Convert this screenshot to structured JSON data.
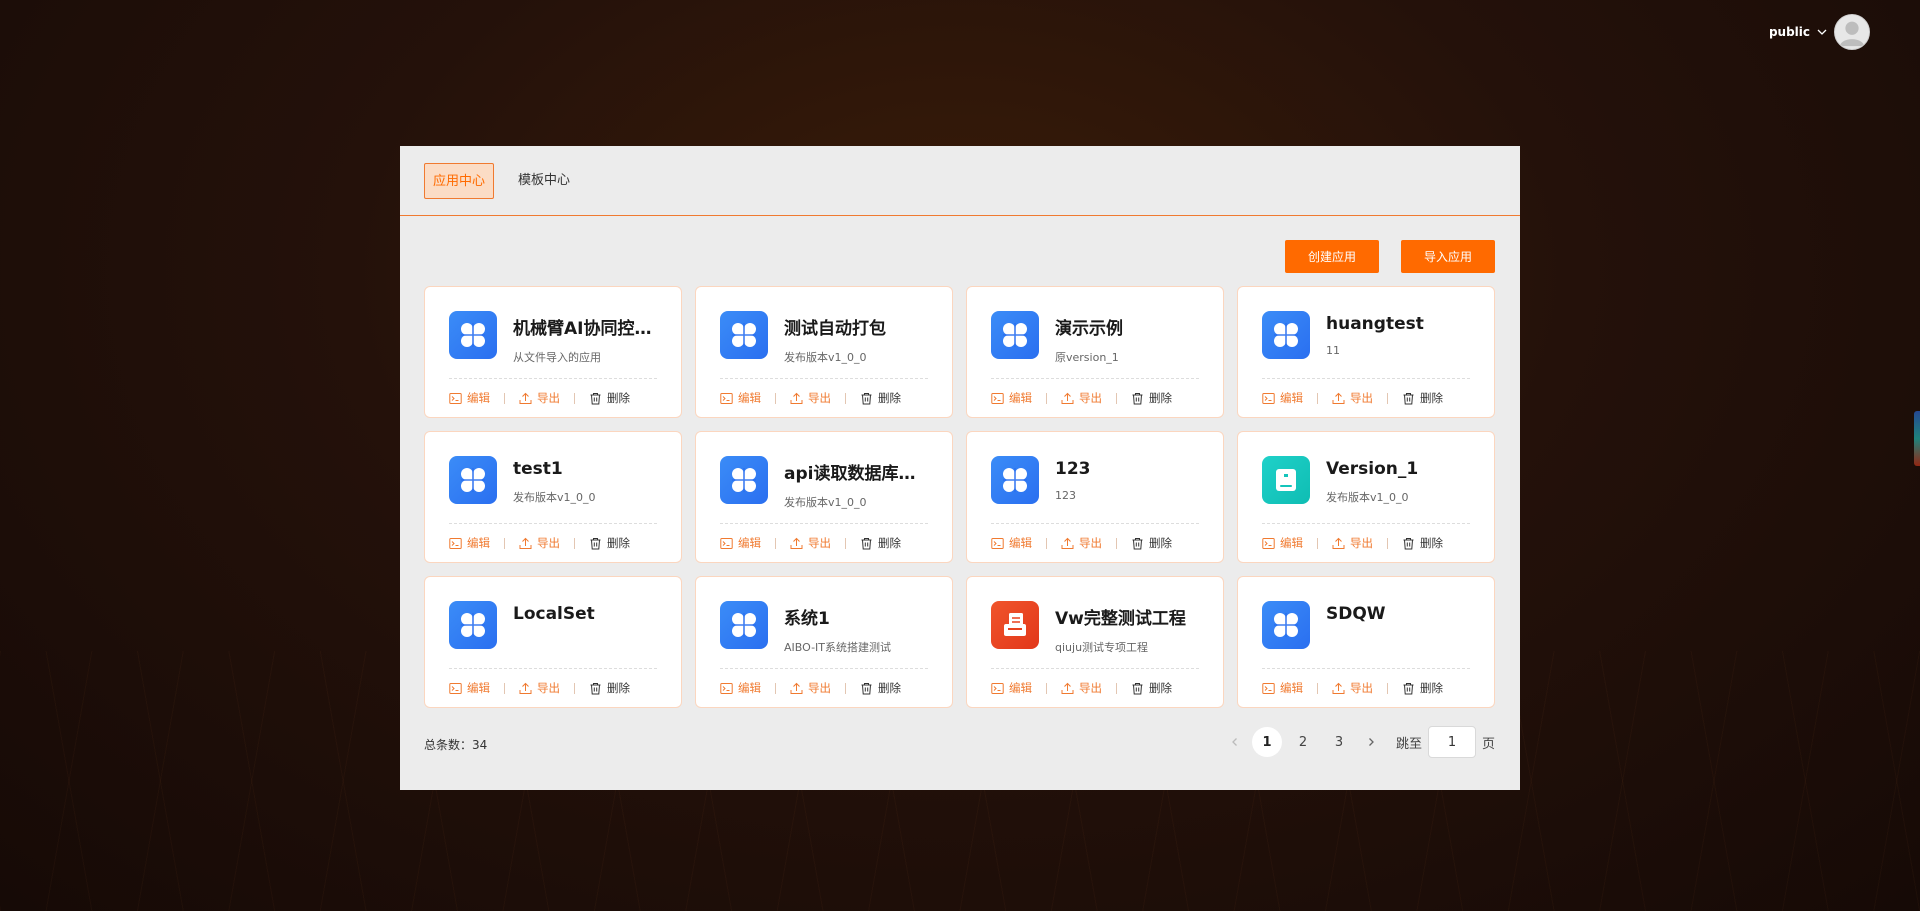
{
  "header": {
    "username": "public"
  },
  "tabs": [
    {
      "label": "应用中心",
      "active": true
    },
    {
      "label": "模板中心",
      "active": false
    }
  ],
  "actions": {
    "create_label": "创建应用",
    "import_label": "导入应用"
  },
  "card_actions": {
    "edit": "编辑",
    "export": "导出",
    "delete": "删除"
  },
  "apps": [
    {
      "title": "机械臂AI协同控…",
      "subtitle": "从文件导入的应用",
      "icon": "clover-icon",
      "color": "blue"
    },
    {
      "title": "测试自动打包",
      "subtitle": "发布版本v1_0_0",
      "icon": "clover-icon",
      "color": "blue"
    },
    {
      "title": "演示示例",
      "subtitle": "原version_1",
      "icon": "clover-icon",
      "color": "blue"
    },
    {
      "title": "huangtest",
      "subtitle": "11",
      "icon": "clover-icon",
      "color": "blue"
    },
    {
      "title": "test1",
      "subtitle": "发布版本v1_0_0",
      "icon": "clover-icon",
      "color": "blue"
    },
    {
      "title": "api读取数据库…",
      "subtitle": "发布版本v1_0_0",
      "icon": "clover-icon",
      "color": "blue"
    },
    {
      "title": "123",
      "subtitle": "123",
      "icon": "clover-icon",
      "color": "blue"
    },
    {
      "title": "Version_1",
      "subtitle": "发布版本v1_0_0",
      "icon": "box-icon",
      "color": "teal"
    },
    {
      "title": "LocalSet",
      "subtitle": "",
      "icon": "clover-icon",
      "color": "blue"
    },
    {
      "title": "系统1",
      "subtitle": "AIBO-IT系统搭建测试",
      "icon": "clover-icon",
      "color": "blue"
    },
    {
      "title": "Vw完整测试工程",
      "subtitle": "qiuju测试专项工程",
      "icon": "document-icon",
      "color": "red"
    },
    {
      "title": "SDQW",
      "subtitle": "",
      "icon": "clover-icon",
      "color": "blue"
    }
  ],
  "footer": {
    "total_label": "总条数：34",
    "pages": [
      "1",
      "2",
      "3"
    ],
    "current_page": "1",
    "jump_label": "跳至",
    "jump_value": "1",
    "page_suffix": "页"
  },
  "colors": {
    "accent": "#ff6a00",
    "icon_blue": "#2f7ef5",
    "icon_teal": "#14c4bb",
    "icon_red": "#e8421f"
  }
}
